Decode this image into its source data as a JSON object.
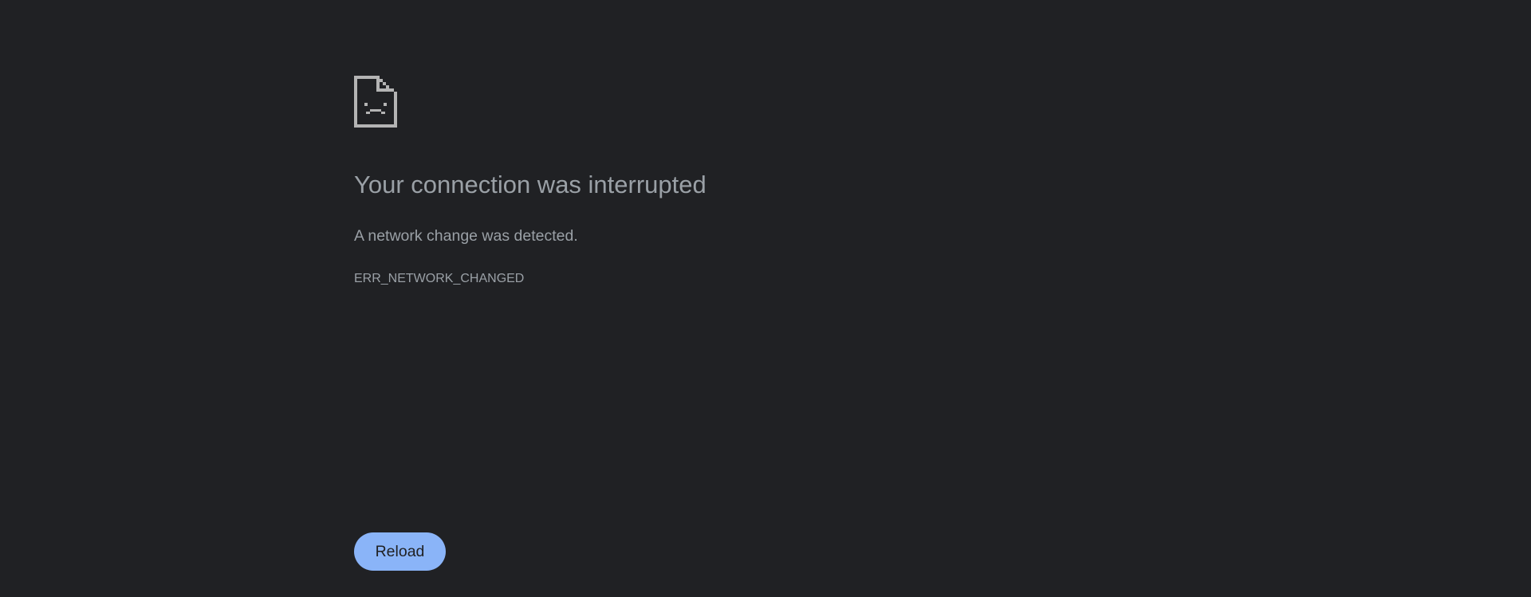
{
  "error_page": {
    "icon": "sad-document-icon",
    "title": "Your connection was interrupted",
    "description": "A network change was detected.",
    "error_code": "ERR_NETWORK_CHANGED",
    "reload_label": "Reload"
  },
  "colors": {
    "background": "#202124",
    "text": "#9aa0a6",
    "icon": "#b4b4b4",
    "button_bg": "#8ab4f8",
    "button_text": "#202124"
  }
}
